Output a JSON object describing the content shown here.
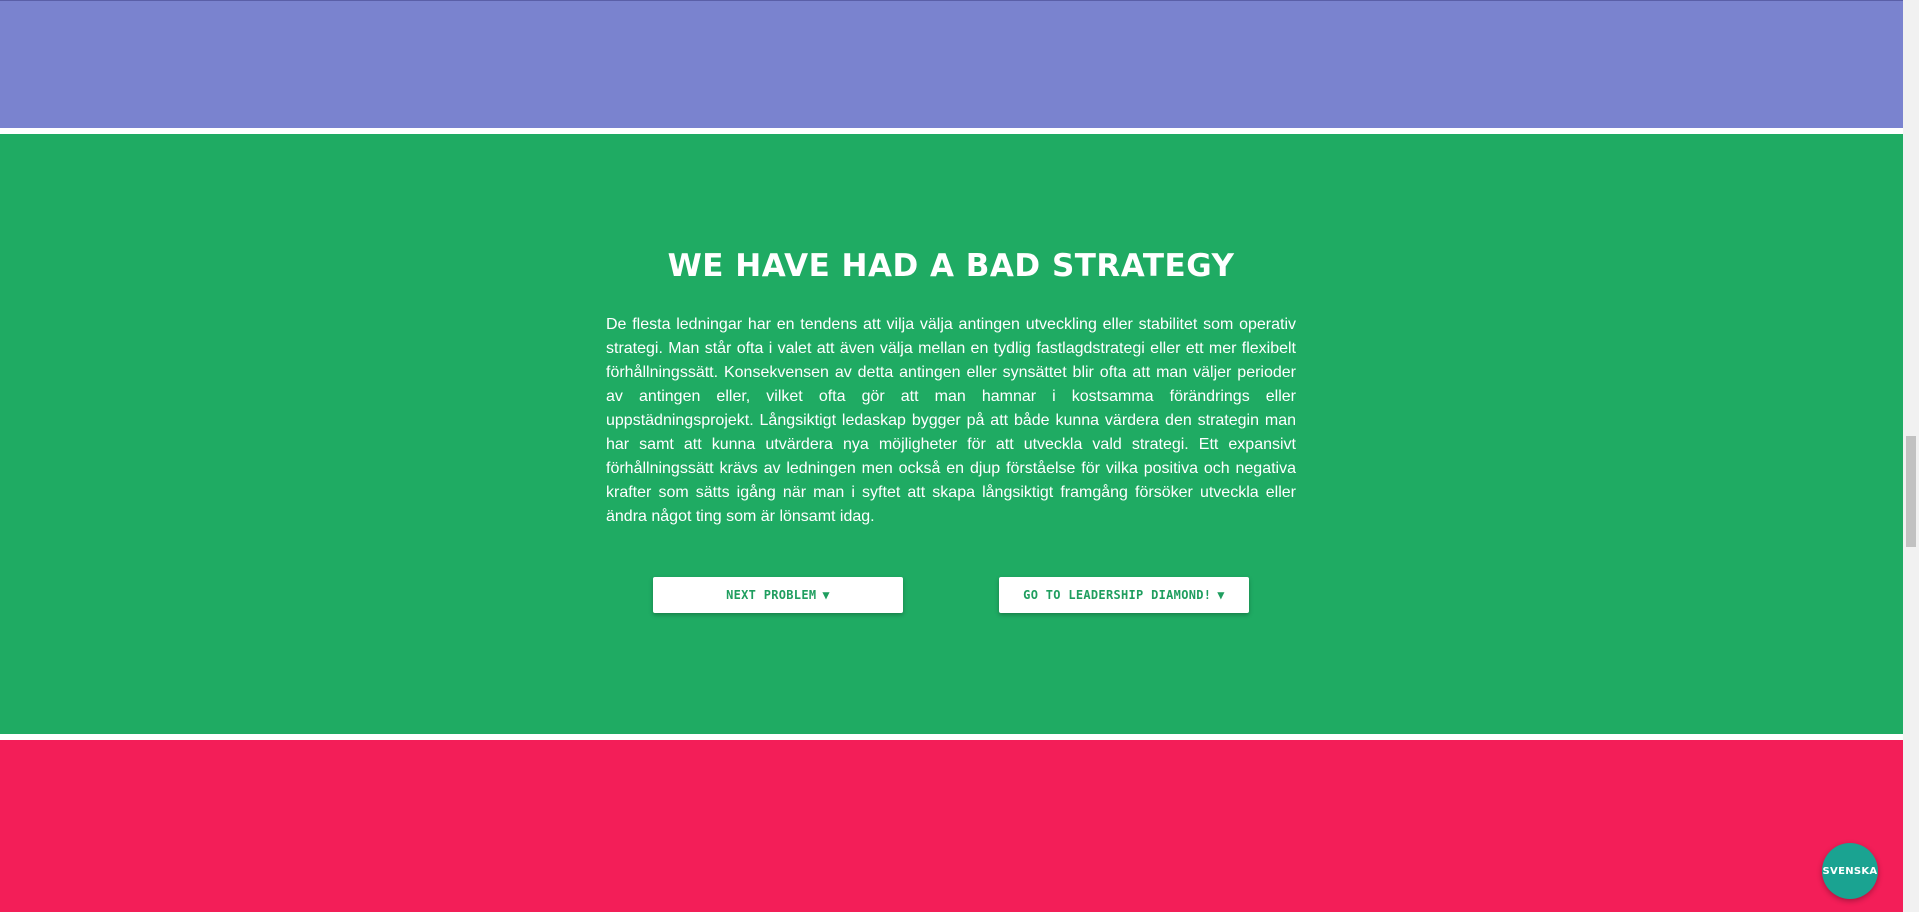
{
  "colors": {
    "purple_band": "#7a83cf",
    "green_band": "#1fab63",
    "red_band": "#f31e58",
    "button_text": "#1f9e5f",
    "lang_button_bg": "#1aa391"
  },
  "section": {
    "title": "WE HAVE HAD A BAD STRATEGY",
    "body": "De flesta ledningar har en tendens att vilja välja antingen utveckling eller stabilitet som operativ strategi. Man står ofta i valet att även välja mellan en tydlig fastlagdstrategi eller ett mer flexibelt förhållningssätt. Konsekvensen av detta antingen eller synsättet blir ofta att man väljer perioder av antingen eller, vilket ofta gör att man hamnar i kostsamma förändrings eller uppstädningsprojekt. Långsiktigt ledaskap bygger på att både kunna värdera den strategin man har samt att kunna utvärdera nya möjligheter för att utveckla vald strategi. Ett expansivt förhållningssätt krävs av ledningen men också en djup förståelse för vilka positiva och negativa krafter som sätts igång när man i syftet att skapa långsiktigt framgång försöker utveckla eller ändra något ting som är lönsamt idag.",
    "buttons": {
      "next_label": "NEXT PROBLEM",
      "diamond_label": "GO TO LEADERSHIP DIAMOND!",
      "arrow_glyph": "▼"
    }
  },
  "language_button": {
    "label": "SVENSKA"
  }
}
